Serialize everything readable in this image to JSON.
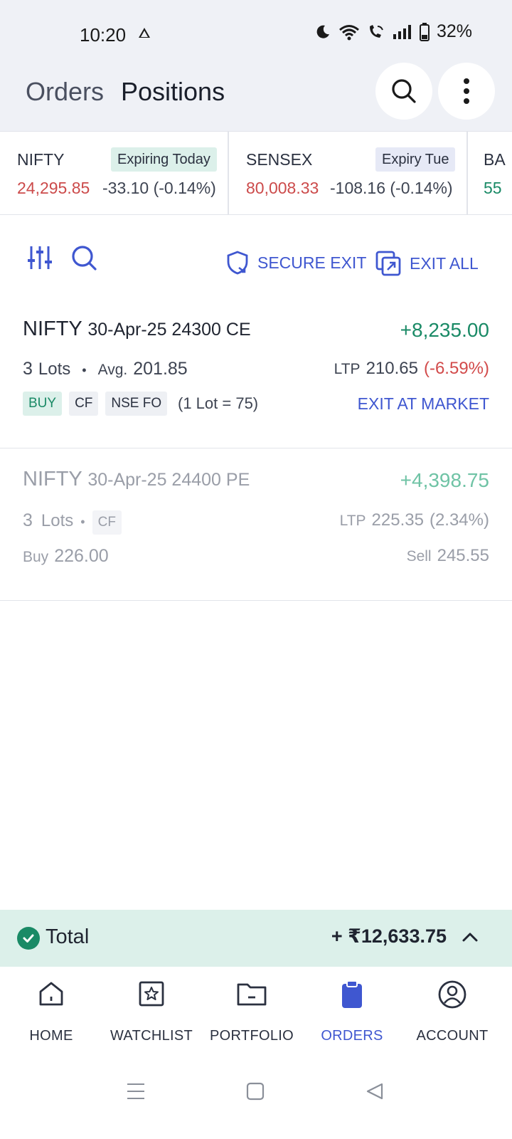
{
  "status_bar": {
    "time": "10:20",
    "battery": "32%",
    "icons": [
      "moon-icon",
      "wifi-icon",
      "wifi-call-icon",
      "signal-icon",
      "battery-icon"
    ]
  },
  "header": {
    "tabs": [
      {
        "label": "Orders",
        "active": false
      },
      {
        "label": "Positions",
        "active": true
      }
    ],
    "icons": [
      "search-icon",
      "more-vertical-icon"
    ]
  },
  "indices": [
    {
      "name": "NIFTY",
      "badge": "Expiring Today",
      "price": "24,295.85",
      "change": "-33.10 (-0.14%)"
    },
    {
      "name": "SENSEX",
      "badge": "Expiry Tue",
      "price": "80,008.33",
      "change": "-108.16 (-0.14%)"
    },
    {
      "name": "BA",
      "price": "55"
    }
  ],
  "toolbar": {
    "secure_exit": "SECURE EXIT",
    "exit_all": "EXIT ALL",
    "icons": [
      "filter-sliders-icon",
      "search-icon",
      "shield-icon",
      "exit-all-icon"
    ]
  },
  "positions": [
    {
      "symbol": "NIFTY",
      "contract": "30-Apr-25 24300 CE",
      "pnl": "+8,235.00",
      "lots": "3",
      "lots_label": "Lots",
      "avg_label": "Avg.",
      "avg": "201.85",
      "ltp_label": "LTP",
      "ltp": "210.65",
      "ltp_change": "(-6.59%)",
      "tags": [
        "BUY",
        "CF",
        "NSE FO"
      ],
      "lot_size": "(1 Lot = 75)",
      "action": "EXIT AT MARKET"
    },
    {
      "symbol": "NIFTY",
      "contract": "30-Apr-25 24400 PE",
      "pnl": "+4,398.75",
      "lots": "3",
      "lots_label": "Lots",
      "tag": "CF",
      "ltp_label": "LTP",
      "ltp": "225.35",
      "ltp_change": "(2.34%)",
      "buy_label": "Buy",
      "buy": "226.00",
      "sell_label": "Sell",
      "sell": "245.55"
    }
  ],
  "total": {
    "label": "Total",
    "value": "+ ₹12,633.75"
  },
  "nav": [
    {
      "label": "HOME",
      "icon": "home-icon",
      "active": false
    },
    {
      "label": "WATCHLIST",
      "icon": "watchlist-star-icon",
      "active": false
    },
    {
      "label": "PORTFOLIO",
      "icon": "portfolio-folder-icon",
      "active": false
    },
    {
      "label": "ORDERS",
      "icon": "orders-clipboard-icon",
      "active": true
    },
    {
      "label": "ACCOUNT",
      "icon": "account-user-icon",
      "active": false
    }
  ],
  "colors": {
    "accent": "#3f57d0",
    "profit": "#1a8a66",
    "loss": "#cc4b4b",
    "header_bg": "#eff1f6",
    "total_bg": "#dcf0ea"
  }
}
